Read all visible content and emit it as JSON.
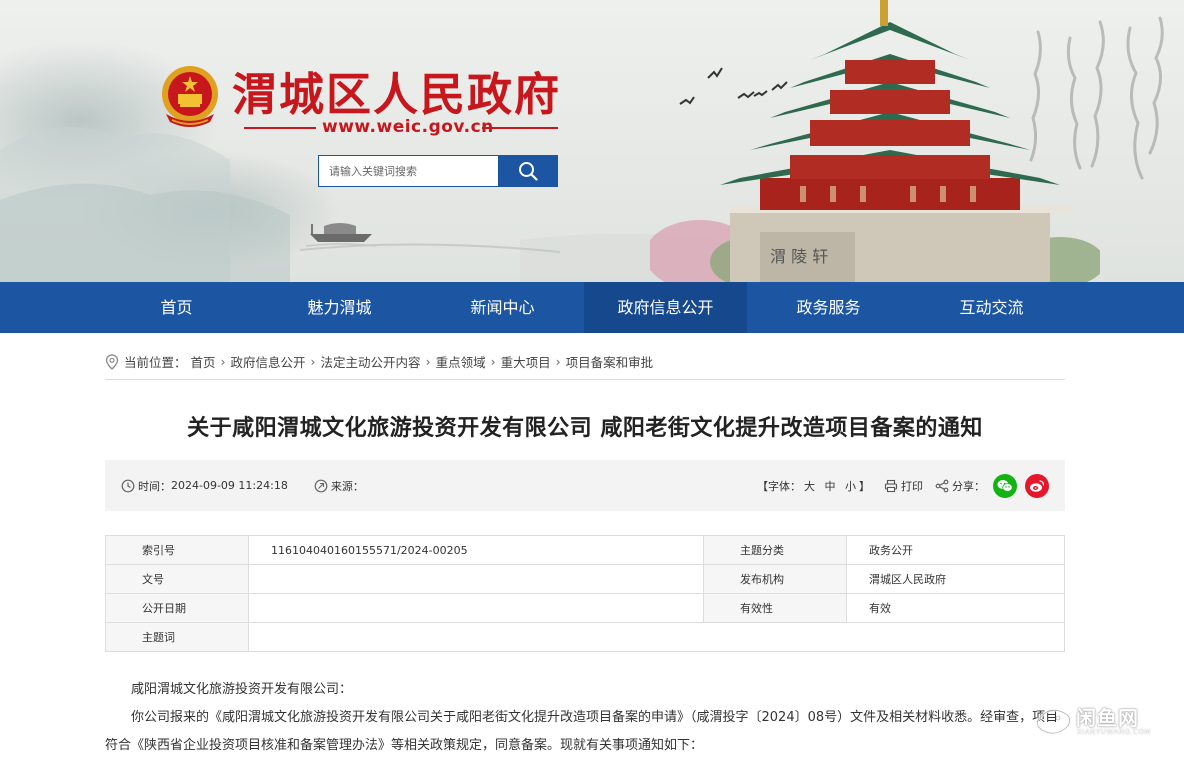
{
  "header": {
    "site_name": "渭城区人民政府",
    "site_url": "www.weic.gov.cn",
    "search_placeholder": "请输入关键词搜索"
  },
  "nav": {
    "items": [
      "首页",
      "魅力渭城",
      "新闻中心",
      "政府信息公开",
      "政务服务",
      "互动交流"
    ],
    "active": "政府信息公开"
  },
  "breadcrumb": {
    "label": "当前位置：",
    "items": [
      "首页",
      "政府信息公开",
      "法定主动公开内容",
      "重点领域",
      "重大项目",
      "项目备案和审批"
    ]
  },
  "article": {
    "title": "关于咸阳渭城文化旅游投资开发有限公司 咸阳老街文化提升改造项目备案的通知",
    "time_label": "时间：",
    "time_value": "2024-09-09 11:24:18",
    "source_label": "来源：",
    "font_label_open": "【字体：",
    "font_large": "大",
    "font_medium": "中",
    "font_small": "小",
    "font_label_close": "】",
    "print_label": "打印",
    "share_label": "分享："
  },
  "meta": {
    "index_label": "索引号",
    "index_value": "116104040160155571/2024-00205",
    "topic_label": "主题分类",
    "topic_value": "政务公开",
    "docno_label": "文号",
    "docno_value": "",
    "publisher_label": "发布机构",
    "publisher_value": "渭城区人民政府",
    "date_label": "公开日期",
    "date_value": "",
    "validity_label": "有效性",
    "validity_value": "有效",
    "keywords_label": "主题词",
    "keywords_value": ""
  },
  "content": {
    "addressee": "咸阳渭城文化旅游投资开发有限公司：",
    "paragraph1": "你公司报来的《咸阳渭城文化旅游投资开发有限公司关于咸阳老街文化提升改造项目备案的申请》（咸渭投字〔2024〕08号）文件及相关材料收悉。经审查，项目符合《陕西省企业投资项目核准和备案管理办法》等相关政策规定，同意备案。现就有关事项通知如下："
  },
  "watermark": {
    "text": "闲鱼网",
    "url": "XIANYUWANG.COM"
  },
  "colors": {
    "brand_blue": "#1c56a3",
    "brand_red": "#c8161d",
    "wechat_green": "#12b312",
    "weibo_red": "#e6162d"
  }
}
